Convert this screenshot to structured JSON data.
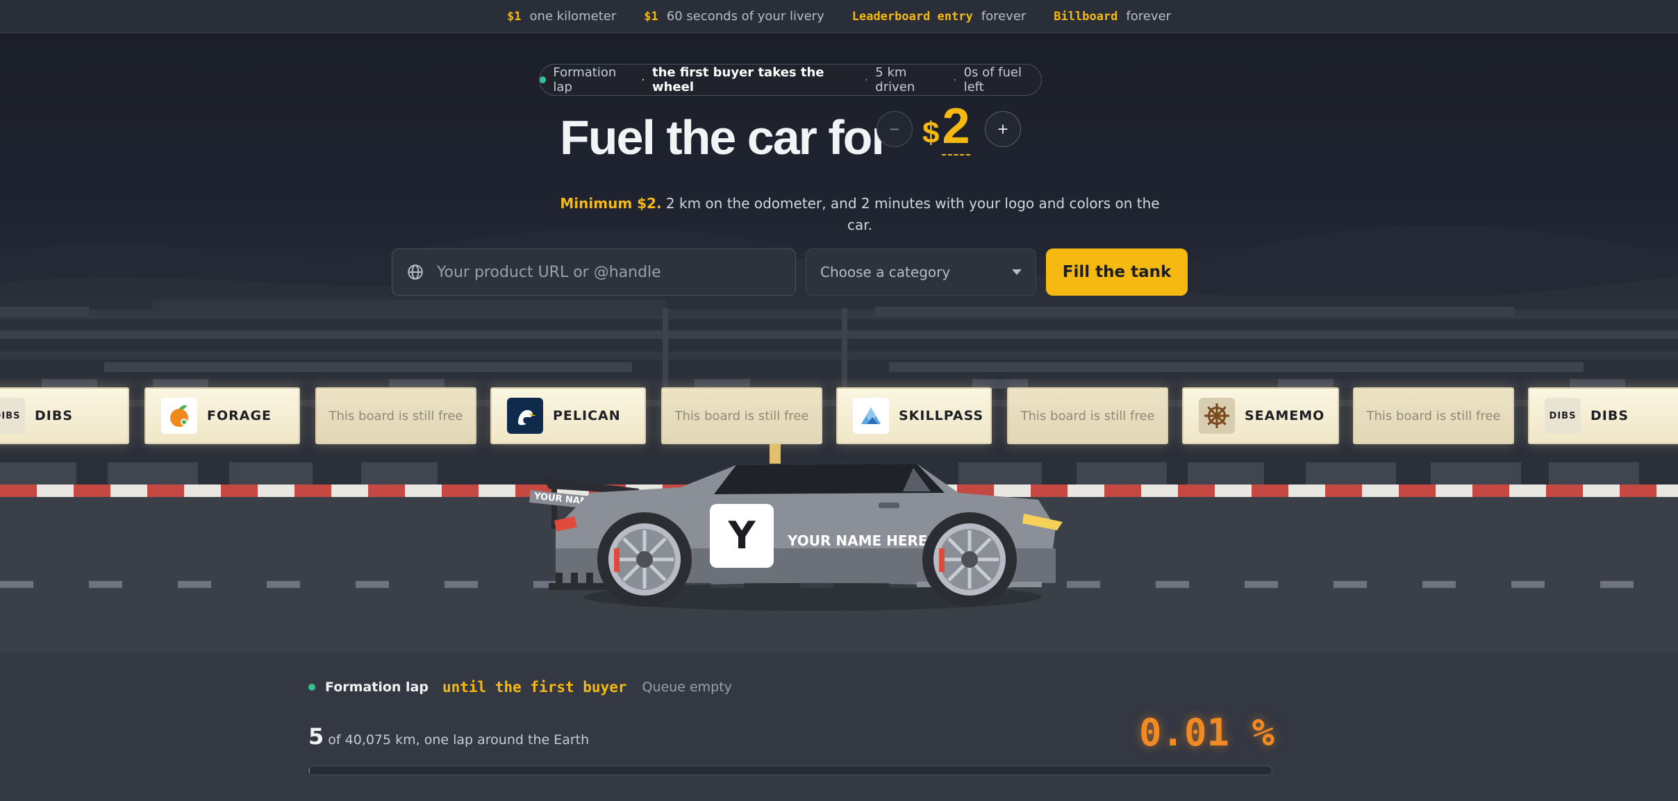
{
  "pricing": [
    {
      "price": "$1",
      "item": "one kilometer"
    },
    {
      "price": "$1",
      "item": "60 seconds of your livery"
    },
    {
      "price": "Leaderboard entry",
      "item": "forever"
    },
    {
      "price": "Billboard",
      "item": "forever"
    }
  ],
  "status": {
    "state": "Formation lap",
    "middle": "·",
    "highlight": "the first buyer takes the wheel",
    "sep": "·",
    "driven": "5 km driven",
    "fuel": "0s of fuel left"
  },
  "hero": {
    "headline": "Fuel the car for",
    "minus": "−",
    "currency": "$",
    "amount": "2",
    "plus": "+",
    "minimum": "Minimum $2.",
    "description": "2 km on the odometer, and 2 minutes with your logo and colors on the car."
  },
  "form": {
    "url_placeholder": "Your product URL or @handle",
    "category_label": "Choose a category",
    "submit_label": "Fill the tank"
  },
  "billboards": {
    "free_label": "This board is still free",
    "brands": [
      "DIBS",
      "FORAGE",
      "PELICAN",
      "SKILLPASS",
      "SEAMEMO",
      "DIBS"
    ],
    "dibs_logo_text": "DIBS"
  },
  "car": {
    "logo_letter": "Y",
    "livery_text": "YOUR NAME HERE",
    "wing_text": "YOUR NAME HERE"
  },
  "bottom": {
    "state": "Formation lap",
    "until": "until the first buyer",
    "queue": "Queue empty",
    "km": "5",
    "km_text": "of 40,075 km, one lap around the Earth",
    "percent": "0.01 %",
    "progress_fraction": 0.000125
  },
  "colors": {
    "accent": "#f5b912",
    "percent": "#f28a24",
    "live_dot": "#34c38f"
  }
}
